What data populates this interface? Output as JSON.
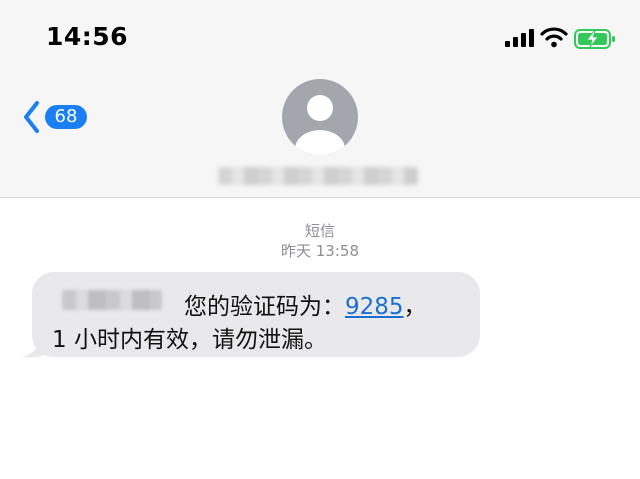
{
  "status_bar": {
    "time": "14:56"
  },
  "nav": {
    "unread_count": "68"
  },
  "conversation": {
    "message_type": "短信",
    "timestamp": "昨天 13:58"
  },
  "message": {
    "text_before_code": "您的验证码为：",
    "code": "9285",
    "text_after_code": "，",
    "line2": "1 小时内有效，请勿泄漏。"
  },
  "colors": {
    "accent": "#1a7ff5",
    "bubble": "#e9e9eb",
    "header_bg": "#f6f6f6",
    "battery_charging": "#34c759"
  },
  "icons": [
    "signal-icon",
    "wifi-icon",
    "battery-charging-icon",
    "back-chevron-icon",
    "avatar-icon"
  ]
}
